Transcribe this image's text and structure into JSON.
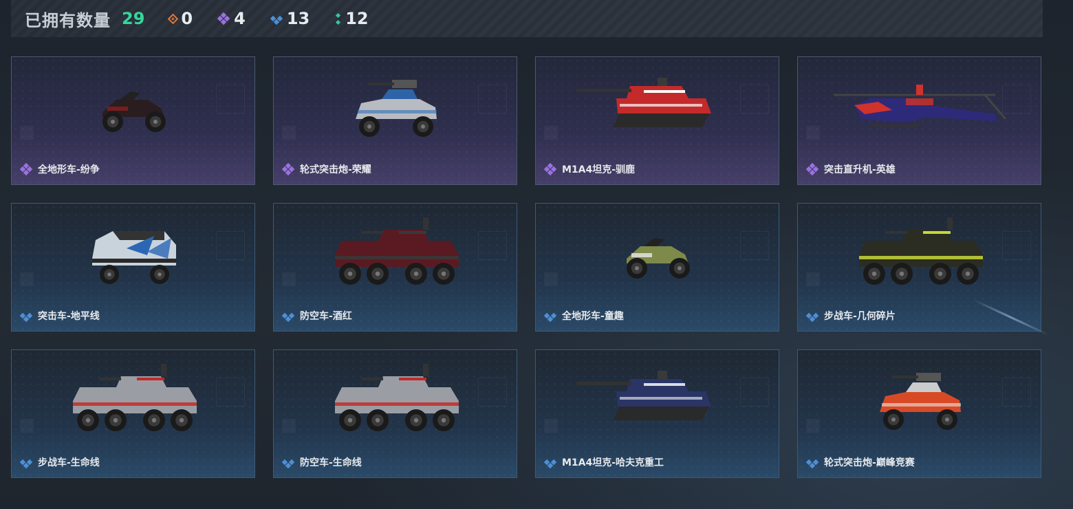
{
  "header": {
    "title": "已拥有数量",
    "total": "29",
    "stats": [
      {
        "icon": "orange-diamond-icon",
        "value": "0",
        "color": "#e07a3c"
      },
      {
        "icon": "purple-diamond-icon",
        "value": "4",
        "color": "#9a72e0"
      },
      {
        "icon": "blue-diamond-icon",
        "value": "13",
        "color": "#4e8fd6"
      },
      {
        "icon": "green-dots-icon",
        "value": "12",
        "color": "#35c9a0"
      }
    ]
  },
  "vehicles": [
    {
      "name": "全地形车-纷争",
      "rarity": "purple",
      "type": "atv",
      "color": "#2a1d1f",
      "accent": "#8a1e1e"
    },
    {
      "name": "轮式突击炮-荣耀",
      "rarity": "purple",
      "type": "assault-car",
      "color": "#b8bcc2",
      "accent": "#2f6fb8"
    },
    {
      "name": "M1A4坦克-驯鹿",
      "rarity": "purple",
      "type": "tank",
      "color": "#c42a2a",
      "accent": "#ffffff"
    },
    {
      "name": "突击直升机-英雄",
      "rarity": "purple",
      "type": "helicopter",
      "color": "#2e2a7a",
      "accent": "#d0332b"
    },
    {
      "name": "突击车-地平线",
      "rarity": "blue",
      "type": "truck",
      "color": "#c9d3dc",
      "accent": "#2c67b5"
    },
    {
      "name": "防空车-酒红",
      "rarity": "blue",
      "type": "apc",
      "color": "#5a1a22",
      "accent": "#3a3a3a"
    },
    {
      "name": "全地形车-童趣",
      "rarity": "blue",
      "type": "atv",
      "color": "#7d8a4a",
      "accent": "#e8e8e8"
    },
    {
      "name": "步战车-几何碎片",
      "rarity": "blue",
      "type": "apc",
      "color": "#2b2d22",
      "accent": "#c8d83a"
    },
    {
      "name": "步战车-生命线",
      "rarity": "blue",
      "type": "apc",
      "color": "#9a9ea4",
      "accent": "#c42a2a"
    },
    {
      "name": "防空车-生命线",
      "rarity": "blue",
      "type": "apc",
      "color": "#9a9ea4",
      "accent": "#c42a2a"
    },
    {
      "name": "M1A4坦克-哈夫克重工",
      "rarity": "blue",
      "type": "tank",
      "color": "#2a3566",
      "accent": "#d9dde4"
    },
    {
      "name": "轮式突击炮-巅峰竞赛",
      "rarity": "blue",
      "type": "assault-car",
      "color": "#d84a26",
      "accent": "#e8e8e8"
    }
  ],
  "rarity_colors": {
    "purple": "#9a72e0",
    "blue": "#4e8fd6"
  }
}
